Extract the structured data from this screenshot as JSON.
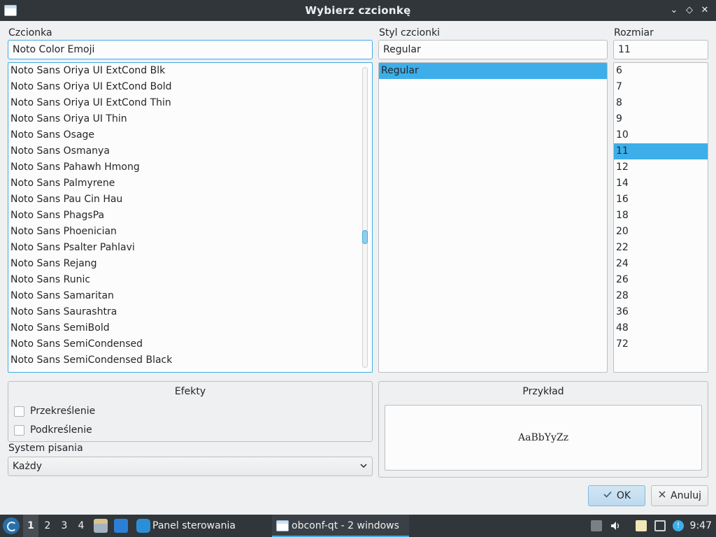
{
  "window": {
    "title": "Wybierz czcionkę",
    "buttons": {
      "minimize": "⌄",
      "maximize": "◇",
      "close": "✕"
    }
  },
  "font": {
    "label": "Czcionka",
    "value": "Noto Color Emoji",
    "items": [
      "Noto Sans Oriya UI ExtCond Blk",
      "Noto Sans Oriya UI ExtCond Bold",
      "Noto Sans Oriya UI ExtCond Thin",
      "Noto Sans Oriya UI Thin",
      "Noto Sans Osage",
      "Noto Sans Osmanya",
      "Noto Sans Pahawh Hmong",
      "Noto Sans Palmyrene",
      "Noto Sans Pau Cin Hau",
      "Noto Sans PhagsPa",
      "Noto Sans Phoenician",
      "Noto Sans Psalter Pahlavi",
      "Noto Sans Rejang",
      "Noto Sans Runic",
      "Noto Sans Samaritan",
      "Noto Sans Saurashtra",
      "Noto Sans SemiBold",
      "Noto Sans SemiCondensed",
      "Noto Sans SemiCondensed Black"
    ]
  },
  "style": {
    "label": "Styl czcionki",
    "value": "Regular",
    "items": [
      "Regular"
    ],
    "selected_index": 0
  },
  "size": {
    "label": "Rozmiar",
    "value": "11",
    "items": [
      "6",
      "7",
      "8",
      "9",
      "10",
      "11",
      "12",
      "14",
      "16",
      "18",
      "20",
      "22",
      "24",
      "26",
      "28",
      "36",
      "48",
      "72"
    ],
    "selected_index": 5
  },
  "effects": {
    "title": "Efekty",
    "strikeout": "Przekreślenie",
    "underline": "Podkreślenie"
  },
  "writing_system": {
    "label": "System pisania",
    "value": "Każdy"
  },
  "preview": {
    "title": "Przykład",
    "text": "AaBbYyZz"
  },
  "dialog_buttons": {
    "ok": "OK",
    "cancel": "Anuluj"
  },
  "taskbar": {
    "workspaces": [
      "1",
      "2",
      "3",
      "4"
    ],
    "active_workspace": 0,
    "tasks": [
      {
        "label": "Panel sterowania"
      },
      {
        "label": "obconf-qt - 2 windows"
      }
    ],
    "clock": "9:47"
  }
}
